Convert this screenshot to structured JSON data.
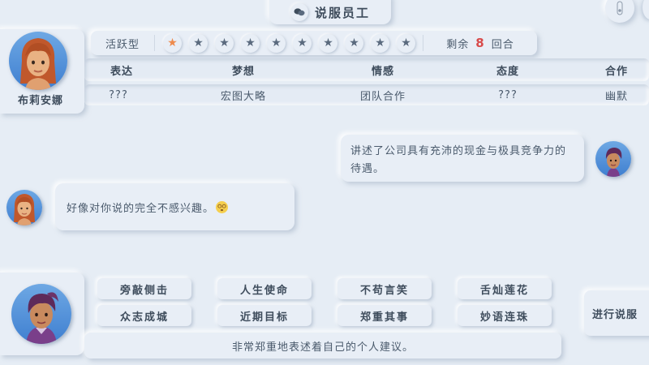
{
  "header": {
    "title": "说服员工",
    "title_icon": "chat-bubbles-icon"
  },
  "employee": {
    "name": "布莉安娜",
    "personality_type": "活跃型",
    "stars_total": 10,
    "stars_filled": 1,
    "rounds_label_before": "剩余",
    "rounds_left": "8",
    "rounds_label_after": "回合"
  },
  "attributes": {
    "headers": [
      "表达",
      "梦想",
      "情感",
      "态度",
      "合作"
    ],
    "values": [
      "???",
      "宏图大略",
      "团队合作",
      "???",
      "幽默"
    ]
  },
  "dialogue": {
    "player_line": "讲述了公司具有充沛的现金与极具竞争力的待遇。",
    "npc_line": "好像对你说的完全不感兴趣。"
  },
  "options": [
    "旁敲侧击",
    "人生使命",
    "不苟言笑",
    "舌灿莲花",
    "众志成城",
    "近期目标",
    "郑重其事",
    "妙语连珠"
  ],
  "action_description": "非常郑重地表述着自己的个人建议。",
  "persuade_button": "进行说服",
  "colors": {
    "background": "#e6edf5",
    "star_on": "#ee8a4c",
    "rounds_number": "#d84a4a"
  }
}
